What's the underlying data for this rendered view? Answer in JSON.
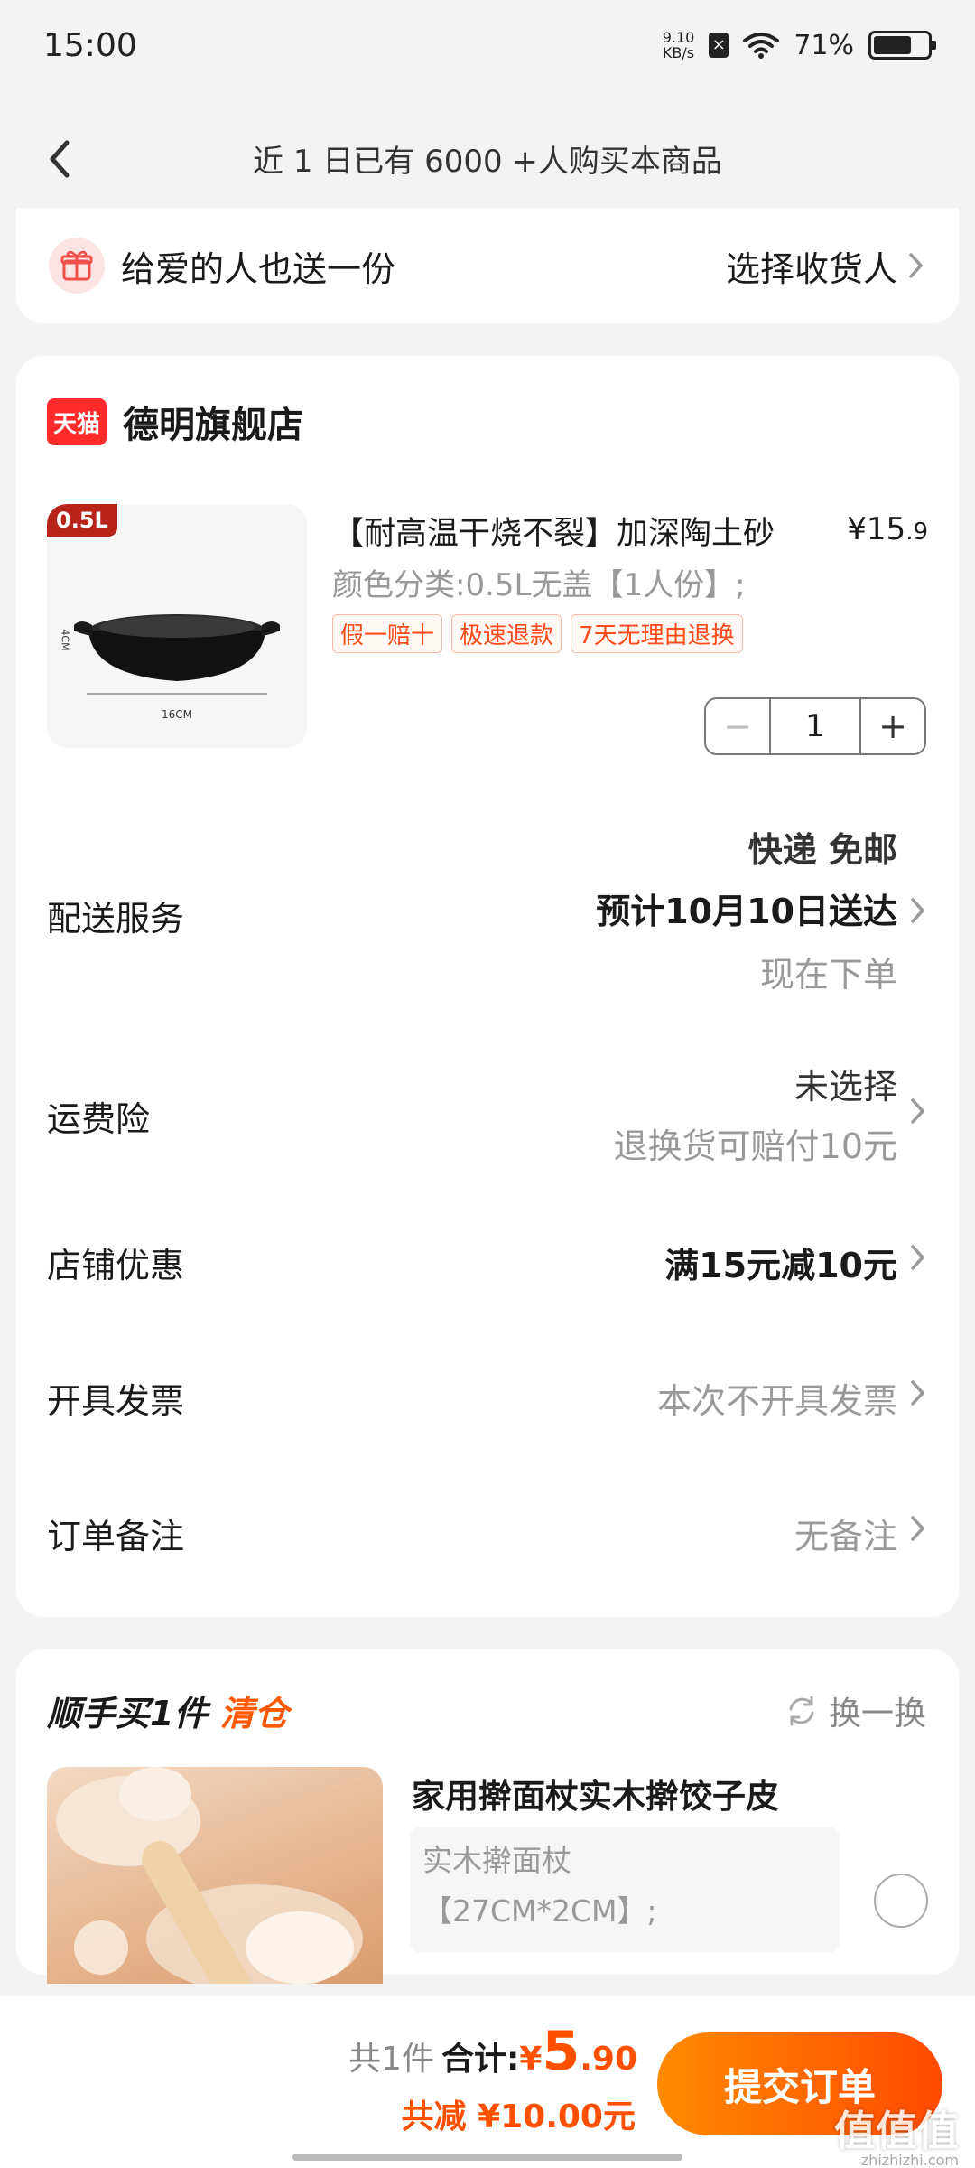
{
  "status": {
    "time": "15:00",
    "net_speed_value": "9.10",
    "net_speed_unit": "KB/s",
    "battery_text": "71%",
    "battery_level": 0.71
  },
  "nav": {
    "title": "近 1 日已有 6000 +人购买本商品"
  },
  "gift": {
    "text": "给爱的人也送一份",
    "action": "选择收货人"
  },
  "store": {
    "badge": "天猫",
    "name": "德明旗舰店"
  },
  "product": {
    "size_tag": "0.5L",
    "dim_width": "16CM",
    "dim_height": "4CM",
    "title": "【耐高温干烧不裂】加深陶土砂",
    "price_symbol": "¥",
    "price_int": "15",
    "price_dec": ".9",
    "spec": "颜色分类:0.5L无盖【1人份】;",
    "tags": [
      "假一赔十",
      "极速退款",
      "7天无理由退换"
    ],
    "quantity": "1",
    "minus": "−",
    "plus": "+"
  },
  "rows": {
    "delivery": {
      "label": "配送服务",
      "line1": "快递 免邮",
      "line2": "预计10月10日送达",
      "line3": "现在下单"
    },
    "shipping_insurance": {
      "label": "运费险",
      "line1": "未选择",
      "line2": "退换货可赔付10元"
    },
    "store_discount": {
      "label": "店铺优惠",
      "value": "满15元减10元"
    },
    "invoice": {
      "label": "开具发票",
      "value": "本次不开具发票"
    },
    "note": {
      "label": "订单备注",
      "value": "无备注"
    }
  },
  "addon": {
    "title": "顺手买1件",
    "title_highlight": "清仓",
    "swap": "换一换",
    "name": "家用擀面杖实木擀饺子皮",
    "spec_line1": "实木擀面杖",
    "spec_line2": "【27CM*2CM】;"
  },
  "bottom": {
    "count": "共1件",
    "total_label": "合计:",
    "currency": "¥",
    "total_int": "5",
    "total_dec": ".90",
    "discount": "共减 ¥10.00元",
    "submit": "提交订单",
    "watermark": "值值值",
    "watermark_sub": "zhizhizhi.com"
  },
  "colors": {
    "accent": "#ff5000",
    "tmall_red": "#ff2b2b",
    "tag_orange": "#ff4a1a"
  }
}
